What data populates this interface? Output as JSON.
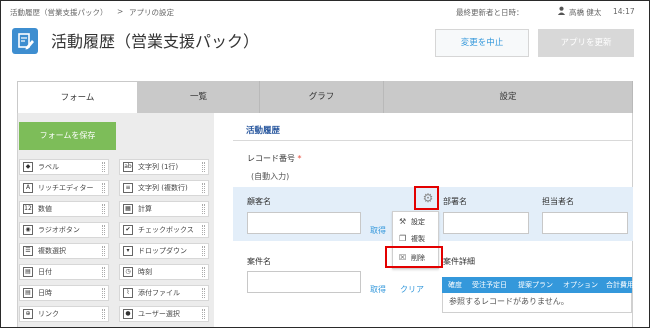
{
  "breadcrumb": {
    "app": "活動履歴（営業支援パック）",
    "separator": ">",
    "current": "アプリの設定"
  },
  "meta": {
    "updated_label": "最終更新者と日時：",
    "user_name": "高橋 健太",
    "time": "14:17"
  },
  "header": {
    "title": "活動履歴（営業支援パック）",
    "cancel_label": "変更を中止",
    "update_label": "アプリを更新"
  },
  "tabs": [
    {
      "label": "フォーム",
      "active": true
    },
    {
      "label": "一覧",
      "active": false
    },
    {
      "label": "グラフ",
      "active": false
    },
    {
      "label": "設定",
      "active": false
    }
  ],
  "palette": {
    "save_label": "フォームを保存",
    "items": [
      {
        "label": "ラベル",
        "icon": "label-icon",
        "glyph": "◆"
      },
      {
        "label": "文字列 (1行)",
        "icon": "text-single-icon",
        "glyph": "ab"
      },
      {
        "label": "リッチエディター",
        "icon": "rich-editor-icon",
        "glyph": "A"
      },
      {
        "label": "文字列 (複数行)",
        "icon": "text-multi-icon",
        "glyph": "≡"
      },
      {
        "label": "数値",
        "icon": "number-icon",
        "glyph": "12"
      },
      {
        "label": "計算",
        "icon": "calc-icon",
        "glyph": "▦"
      },
      {
        "label": "ラジオボタン",
        "icon": "radio-icon",
        "glyph": "◉"
      },
      {
        "label": "チェックボックス",
        "icon": "checkbox-icon",
        "glyph": "✔"
      },
      {
        "label": "複数選択",
        "icon": "multi-select-icon",
        "glyph": "☰"
      },
      {
        "label": "ドロップダウン",
        "icon": "dropdown-icon",
        "glyph": "▾"
      },
      {
        "label": "日付",
        "icon": "date-icon",
        "glyph": "▤"
      },
      {
        "label": "時刻",
        "icon": "time-icon",
        "glyph": "◷"
      },
      {
        "label": "日時",
        "icon": "datetime-icon",
        "glyph": "▤"
      },
      {
        "label": "添付ファイル",
        "icon": "attachment-icon",
        "glyph": "⌇"
      },
      {
        "label": "リンク",
        "icon": "link-icon",
        "glyph": "⊕"
      },
      {
        "label": "ユーザー選択",
        "icon": "user-select-icon",
        "glyph": "●"
      }
    ]
  },
  "form": {
    "heading": "活動履歴",
    "record_no_label": "レコード番号",
    "required_mark": "*",
    "auto_text": "(自動入力)",
    "customer_label": "顧客名",
    "dept_label": "部署名",
    "person_label": "担当者名",
    "fetch_label": "取得",
    "clear_label": "クリア",
    "case_label": "案件名",
    "case_detail_label": "案件詳細",
    "fetch_label2": "取得",
    "clear_label2": "クリア"
  },
  "context_menu": {
    "items": [
      {
        "label": "設定",
        "icon": "settings-icon",
        "glyph": "⚒"
      },
      {
        "label": "複製",
        "icon": "duplicate-icon",
        "glyph": "❐"
      },
      {
        "label": "削除",
        "icon": "delete-icon",
        "glyph": "☒"
      }
    ]
  },
  "subtable": {
    "headers": [
      "確度",
      "受注予定日",
      "提案プラン",
      "オプション",
      "合計費用"
    ],
    "empty_text": "参照するレコードがありません。"
  },
  "colors": {
    "accent_blue": "#3498db",
    "save_green": "#7dbd59",
    "highlight_red": "#e30000",
    "selected_row": "#e3eef9"
  }
}
